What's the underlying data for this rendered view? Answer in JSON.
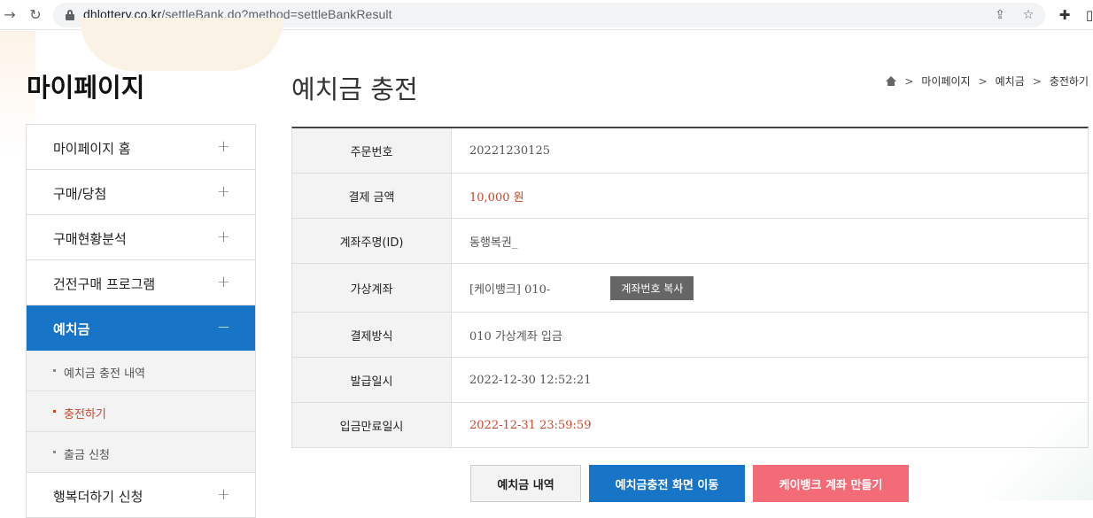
{
  "browser": {
    "url_host": "dhlottery.co.kr",
    "url_path": "/settleBank.do?method=settleBankResult"
  },
  "sidebar": {
    "heading": "마이페이지",
    "items": [
      {
        "label": "마이페이지 홈",
        "toggle": "+"
      },
      {
        "label": "구매/당첨",
        "toggle": "+"
      },
      {
        "label": "구매현황분석",
        "toggle": "+"
      },
      {
        "label": "건전구매 프로그램",
        "toggle": "+"
      },
      {
        "label": "예치금",
        "toggle": "−"
      }
    ],
    "sub_items": [
      {
        "label": "예치금 충전 내역"
      },
      {
        "label": "충전하기"
      },
      {
        "label": "출금 신청"
      }
    ],
    "last_item": {
      "label": "행복더하기 신청",
      "toggle": "+"
    }
  },
  "main": {
    "title": "예치금 충전",
    "breadcrumb": [
      "마이페이지",
      "예치금",
      "충전하기"
    ],
    "rows": [
      {
        "label": "주문번호",
        "value": "20221230125"
      },
      {
        "label": "결제 금액",
        "value": "10,000 원"
      },
      {
        "label": "계좌주명(ID)",
        "value": "동행복권_"
      },
      {
        "label": "가상계좌",
        "value": "[케이뱅크] 010-"
      },
      {
        "label": "결제방식",
        "value": "010 가상계좌 입금"
      },
      {
        "label": "발급일시",
        "value": "2022-12-30 12:52:21"
      },
      {
        "label": "입금만료일시",
        "value": "2022-12-31 23:59:59"
      }
    ],
    "copy_button": "계좌번호 복사",
    "buttons": {
      "history": "예치금 내역",
      "recharge": "예치금충전 화면 이동",
      "kbank": "케이뱅크 계좌 만들기"
    }
  },
  "colors": {
    "primary": "#1874c6",
    "accent_red": "#c8462a",
    "pink": "#f46b78"
  }
}
